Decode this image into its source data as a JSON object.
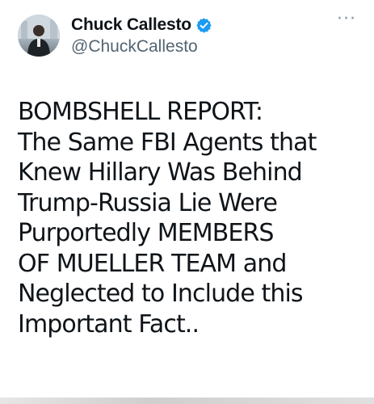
{
  "author": {
    "display_name": "Chuck Callesto",
    "handle": "@ChuckCallesto",
    "verified_icon": "verified-badge-icon",
    "avatar_icon": "profile-photo"
  },
  "menu": {
    "more_label": "···",
    "more_icon": "more-options-icon"
  },
  "tweet": {
    "lines": [
      "BOMBSHELL REPORT:",
      "The Same FBI Agents that",
      "Knew Hillary Was Behind",
      "Trump-Russia Lie Were",
      "Purportedly MEMBERS",
      "OF MUELLER TEAM and",
      "Neglected to Include this",
      "Important Fact.."
    ]
  },
  "colors": {
    "text": "#0f1419",
    "secondary": "#536471",
    "verified": "#1d9bf0",
    "background": "#ffffff"
  }
}
